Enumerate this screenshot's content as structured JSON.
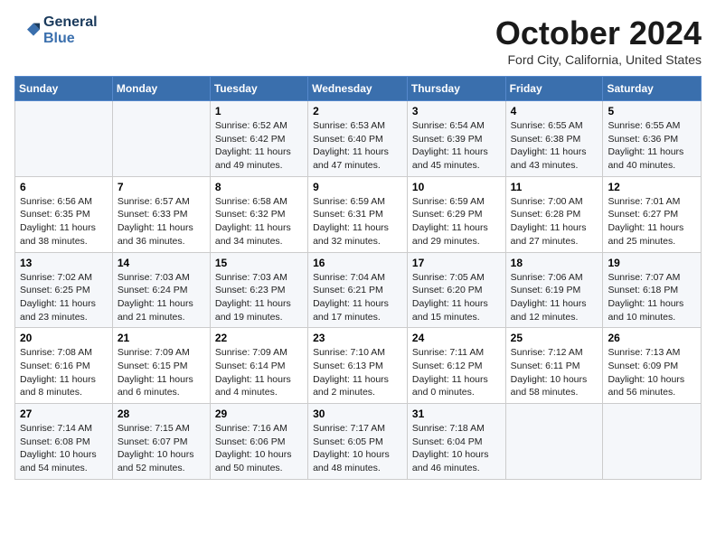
{
  "header": {
    "logo_line1": "General",
    "logo_line2": "Blue",
    "month_title": "October 2024",
    "location": "Ford City, California, United States"
  },
  "weekdays": [
    "Sunday",
    "Monday",
    "Tuesday",
    "Wednesday",
    "Thursday",
    "Friday",
    "Saturday"
  ],
  "weeks": [
    [
      {
        "day": "",
        "info": ""
      },
      {
        "day": "",
        "info": ""
      },
      {
        "day": "1",
        "info": "Sunrise: 6:52 AM\nSunset: 6:42 PM\nDaylight: 11 hours and 49 minutes."
      },
      {
        "day": "2",
        "info": "Sunrise: 6:53 AM\nSunset: 6:40 PM\nDaylight: 11 hours and 47 minutes."
      },
      {
        "day": "3",
        "info": "Sunrise: 6:54 AM\nSunset: 6:39 PM\nDaylight: 11 hours and 45 minutes."
      },
      {
        "day": "4",
        "info": "Sunrise: 6:55 AM\nSunset: 6:38 PM\nDaylight: 11 hours and 43 minutes."
      },
      {
        "day": "5",
        "info": "Sunrise: 6:55 AM\nSunset: 6:36 PM\nDaylight: 11 hours and 40 minutes."
      }
    ],
    [
      {
        "day": "6",
        "info": "Sunrise: 6:56 AM\nSunset: 6:35 PM\nDaylight: 11 hours and 38 minutes."
      },
      {
        "day": "7",
        "info": "Sunrise: 6:57 AM\nSunset: 6:33 PM\nDaylight: 11 hours and 36 minutes."
      },
      {
        "day": "8",
        "info": "Sunrise: 6:58 AM\nSunset: 6:32 PM\nDaylight: 11 hours and 34 minutes."
      },
      {
        "day": "9",
        "info": "Sunrise: 6:59 AM\nSunset: 6:31 PM\nDaylight: 11 hours and 32 minutes."
      },
      {
        "day": "10",
        "info": "Sunrise: 6:59 AM\nSunset: 6:29 PM\nDaylight: 11 hours and 29 minutes."
      },
      {
        "day": "11",
        "info": "Sunrise: 7:00 AM\nSunset: 6:28 PM\nDaylight: 11 hours and 27 minutes."
      },
      {
        "day": "12",
        "info": "Sunrise: 7:01 AM\nSunset: 6:27 PM\nDaylight: 11 hours and 25 minutes."
      }
    ],
    [
      {
        "day": "13",
        "info": "Sunrise: 7:02 AM\nSunset: 6:25 PM\nDaylight: 11 hours and 23 minutes."
      },
      {
        "day": "14",
        "info": "Sunrise: 7:03 AM\nSunset: 6:24 PM\nDaylight: 11 hours and 21 minutes."
      },
      {
        "day": "15",
        "info": "Sunrise: 7:03 AM\nSunset: 6:23 PM\nDaylight: 11 hours and 19 minutes."
      },
      {
        "day": "16",
        "info": "Sunrise: 7:04 AM\nSunset: 6:21 PM\nDaylight: 11 hours and 17 minutes."
      },
      {
        "day": "17",
        "info": "Sunrise: 7:05 AM\nSunset: 6:20 PM\nDaylight: 11 hours and 15 minutes."
      },
      {
        "day": "18",
        "info": "Sunrise: 7:06 AM\nSunset: 6:19 PM\nDaylight: 11 hours and 12 minutes."
      },
      {
        "day": "19",
        "info": "Sunrise: 7:07 AM\nSunset: 6:18 PM\nDaylight: 11 hours and 10 minutes."
      }
    ],
    [
      {
        "day": "20",
        "info": "Sunrise: 7:08 AM\nSunset: 6:16 PM\nDaylight: 11 hours and 8 minutes."
      },
      {
        "day": "21",
        "info": "Sunrise: 7:09 AM\nSunset: 6:15 PM\nDaylight: 11 hours and 6 minutes."
      },
      {
        "day": "22",
        "info": "Sunrise: 7:09 AM\nSunset: 6:14 PM\nDaylight: 11 hours and 4 minutes."
      },
      {
        "day": "23",
        "info": "Sunrise: 7:10 AM\nSunset: 6:13 PM\nDaylight: 11 hours and 2 minutes."
      },
      {
        "day": "24",
        "info": "Sunrise: 7:11 AM\nSunset: 6:12 PM\nDaylight: 11 hours and 0 minutes."
      },
      {
        "day": "25",
        "info": "Sunrise: 7:12 AM\nSunset: 6:11 PM\nDaylight: 10 hours and 58 minutes."
      },
      {
        "day": "26",
        "info": "Sunrise: 7:13 AM\nSunset: 6:09 PM\nDaylight: 10 hours and 56 minutes."
      }
    ],
    [
      {
        "day": "27",
        "info": "Sunrise: 7:14 AM\nSunset: 6:08 PM\nDaylight: 10 hours and 54 minutes."
      },
      {
        "day": "28",
        "info": "Sunrise: 7:15 AM\nSunset: 6:07 PM\nDaylight: 10 hours and 52 minutes."
      },
      {
        "day": "29",
        "info": "Sunrise: 7:16 AM\nSunset: 6:06 PM\nDaylight: 10 hours and 50 minutes."
      },
      {
        "day": "30",
        "info": "Sunrise: 7:17 AM\nSunset: 6:05 PM\nDaylight: 10 hours and 48 minutes."
      },
      {
        "day": "31",
        "info": "Sunrise: 7:18 AM\nSunset: 6:04 PM\nDaylight: 10 hours and 46 minutes."
      },
      {
        "day": "",
        "info": ""
      },
      {
        "day": "",
        "info": ""
      }
    ]
  ]
}
